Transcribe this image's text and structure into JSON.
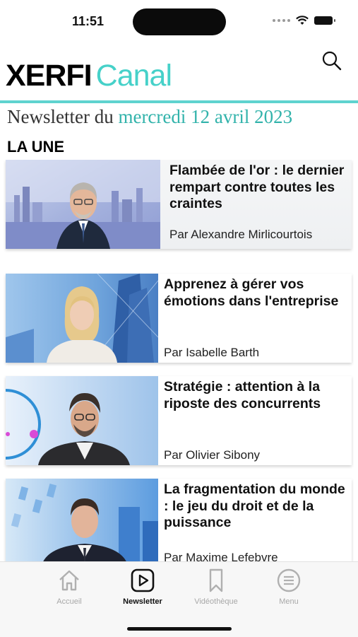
{
  "status": {
    "time": "11:51"
  },
  "brand": {
    "name_part1": "XERFI",
    "name_part2": "Canal",
    "accent": "#46d1c9"
  },
  "header": {
    "search_icon": "search-icon"
  },
  "newsletter": {
    "prefix": "Newsletter du",
    "date": "mercredi 12 avril 2023"
  },
  "section": {
    "title": "LA UNE"
  },
  "articles": [
    {
      "title": "Flambée de l'or : le dernier rempart contre toutes les craintes",
      "author": "Par Alexandre Mirlicourtois"
    },
    {
      "title": "Apprenez à gérer vos émotions dans l'entreprise",
      "author": "Par Isabelle Barth"
    },
    {
      "title": "Stratégie : attention à la riposte des concurrents",
      "author": "Par Olivier Sibony"
    },
    {
      "title": "La fragmentation du monde : le jeu du droit et de la puissance",
      "author": "Par Maxime Lefebvre"
    }
  ],
  "tabbar": {
    "items": [
      {
        "label": "Accueil",
        "icon": "home-icon",
        "active": false
      },
      {
        "label": "Newsletter",
        "icon": "play-square-icon",
        "active": true
      },
      {
        "label": "Vidéothèque",
        "icon": "bookmark-icon",
        "active": false
      },
      {
        "label": "Menu",
        "icon": "menu-icon",
        "active": false
      }
    ]
  }
}
